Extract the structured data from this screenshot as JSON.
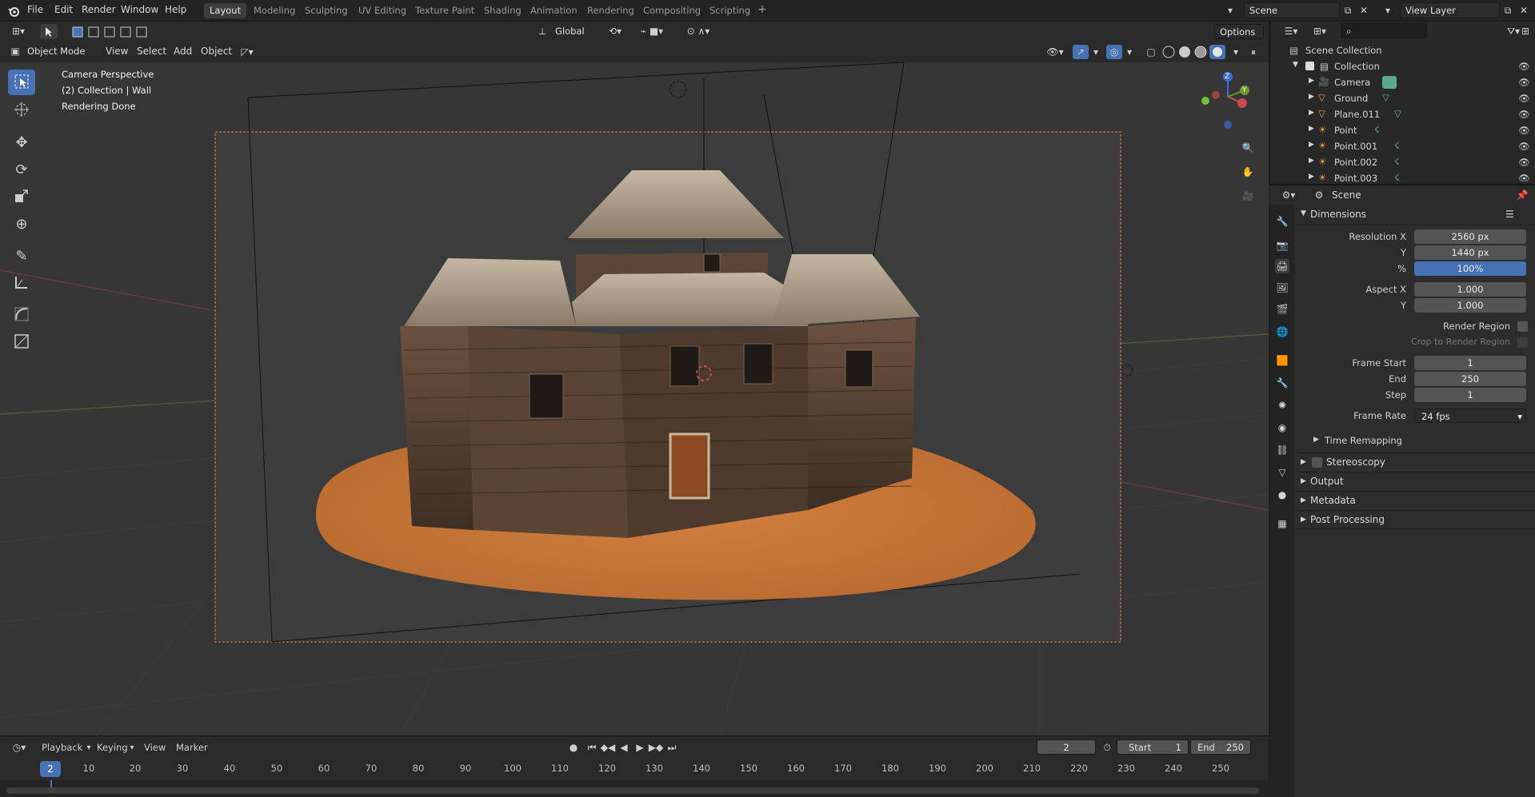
{
  "top_menu": {
    "items": [
      "File",
      "Edit",
      "Render",
      "Window",
      "Help"
    ]
  },
  "workspaces": {
    "tabs": [
      "Layout",
      "Modeling",
      "Sculpting",
      "UV Editing",
      "Texture Paint",
      "Shading",
      "Animation",
      "Rendering",
      "Compositing",
      "Scripting"
    ],
    "active": "Layout",
    "add": "+"
  },
  "scene_field": "Scene",
  "viewlayer_field": "View Layer",
  "tool_header": {
    "transform_orientation": "Global",
    "options_label": "Options"
  },
  "viewport_header": {
    "mode": "Object Mode",
    "menus": [
      "View",
      "Select",
      "Add",
      "Object"
    ]
  },
  "viewport": {
    "info_line1": "Camera Perspective",
    "info_line2": "(2) Collection | Wall",
    "info_line3": "Rendering Done",
    "gizmo": {
      "z": "Z",
      "y": "Y"
    }
  },
  "outliner": {
    "root": "Scene Collection",
    "collection": "Collection",
    "items": [
      "Camera",
      "Ground",
      "Plane.011",
      "Point",
      "Point.001",
      "Point.002",
      "Point.003"
    ]
  },
  "properties": {
    "header": "Scene",
    "dimensions": {
      "title": "Dimensions",
      "res_x_label": "Resolution X",
      "res_x": "2560 px",
      "res_y_label": "Y",
      "res_y": "1440 px",
      "pct_label": "%",
      "pct": "100%",
      "aspect_x_label": "Aspect X",
      "aspect_x": "1.000",
      "aspect_y_label": "Y",
      "aspect_y": "1.000",
      "render_region": "Render Region",
      "crop_region": "Crop to Render Region",
      "frame_start_label": "Frame Start",
      "frame_start": "1",
      "end_label": "End",
      "end": "250",
      "step_label": "Step",
      "step": "1",
      "frame_rate_label": "Frame Rate",
      "frame_rate": "24 fps",
      "time_remapping": "Time Remapping"
    },
    "sections": [
      "Stereoscopy",
      "Output",
      "Metadata",
      "Post Processing"
    ]
  },
  "timeline": {
    "menus": [
      "Playback",
      "Keying",
      "View",
      "Marker"
    ],
    "current_frame": "2",
    "start_label": "Start",
    "start": "1",
    "end_label": "End",
    "end": "250",
    "ruler": [
      "10",
      "20",
      "30",
      "40",
      "50",
      "60",
      "70",
      "80",
      "90",
      "100",
      "110",
      "120",
      "130",
      "140",
      "150",
      "160",
      "170",
      "180",
      "190",
      "200",
      "210",
      "220",
      "230",
      "240",
      "250"
    ],
    "playhead": "2"
  },
  "colors": {
    "accent": "#4772b3",
    "ground": "#c8723a",
    "wall": "#5a4535",
    "roof": "#a89a86"
  }
}
